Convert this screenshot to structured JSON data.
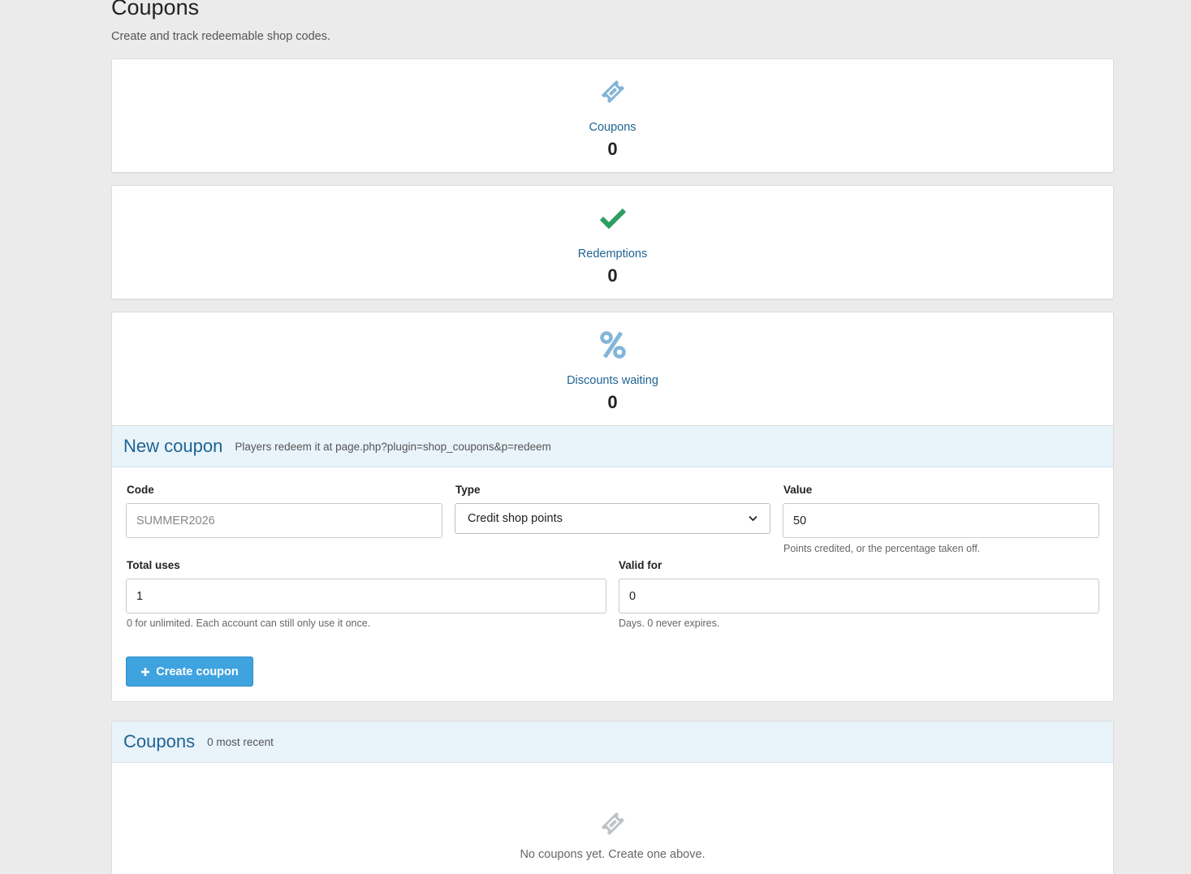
{
  "page": {
    "title": "Coupons",
    "subtitle": "Create and track redeemable shop codes."
  },
  "stats": [
    {
      "label": "Coupons",
      "value": "0",
      "icon": "ticket-icon",
      "color": "#82b5d8"
    },
    {
      "label": "Redemptions",
      "value": "0",
      "icon": "check-icon",
      "color": "#2e9e63"
    },
    {
      "label": "Discounts waiting",
      "value": "0",
      "icon": "percent-icon",
      "color": "#82b5d8"
    }
  ],
  "new_coupon": {
    "title": "New coupon",
    "subtitle": "Players redeem it at page.php?plugin=shop_coupons&p=redeem",
    "code_label": "Code",
    "code_placeholder": "SUMMER2026",
    "code_value": "",
    "type_label": "Type",
    "type_value": "Credit shop points",
    "value_label": "Value",
    "value_value": "50",
    "value_help": "Points credited, or the percentage taken off.",
    "uses_label": "Total uses",
    "uses_value": "1",
    "uses_help": "0 for unlimited. Each account can still only use it once.",
    "valid_label": "Valid for",
    "valid_value": "0",
    "valid_help": "Days. 0 never expires.",
    "create_label": "Create coupon"
  },
  "coupons_list": {
    "title": "Coupons",
    "subtitle": "0 most recent",
    "empty_text": "No coupons yet. Create one above."
  },
  "colors": {
    "accent": "#1f6493",
    "button": "#3fa3e0",
    "success": "#2e9e63",
    "panel_header": "#e8f3fa"
  }
}
